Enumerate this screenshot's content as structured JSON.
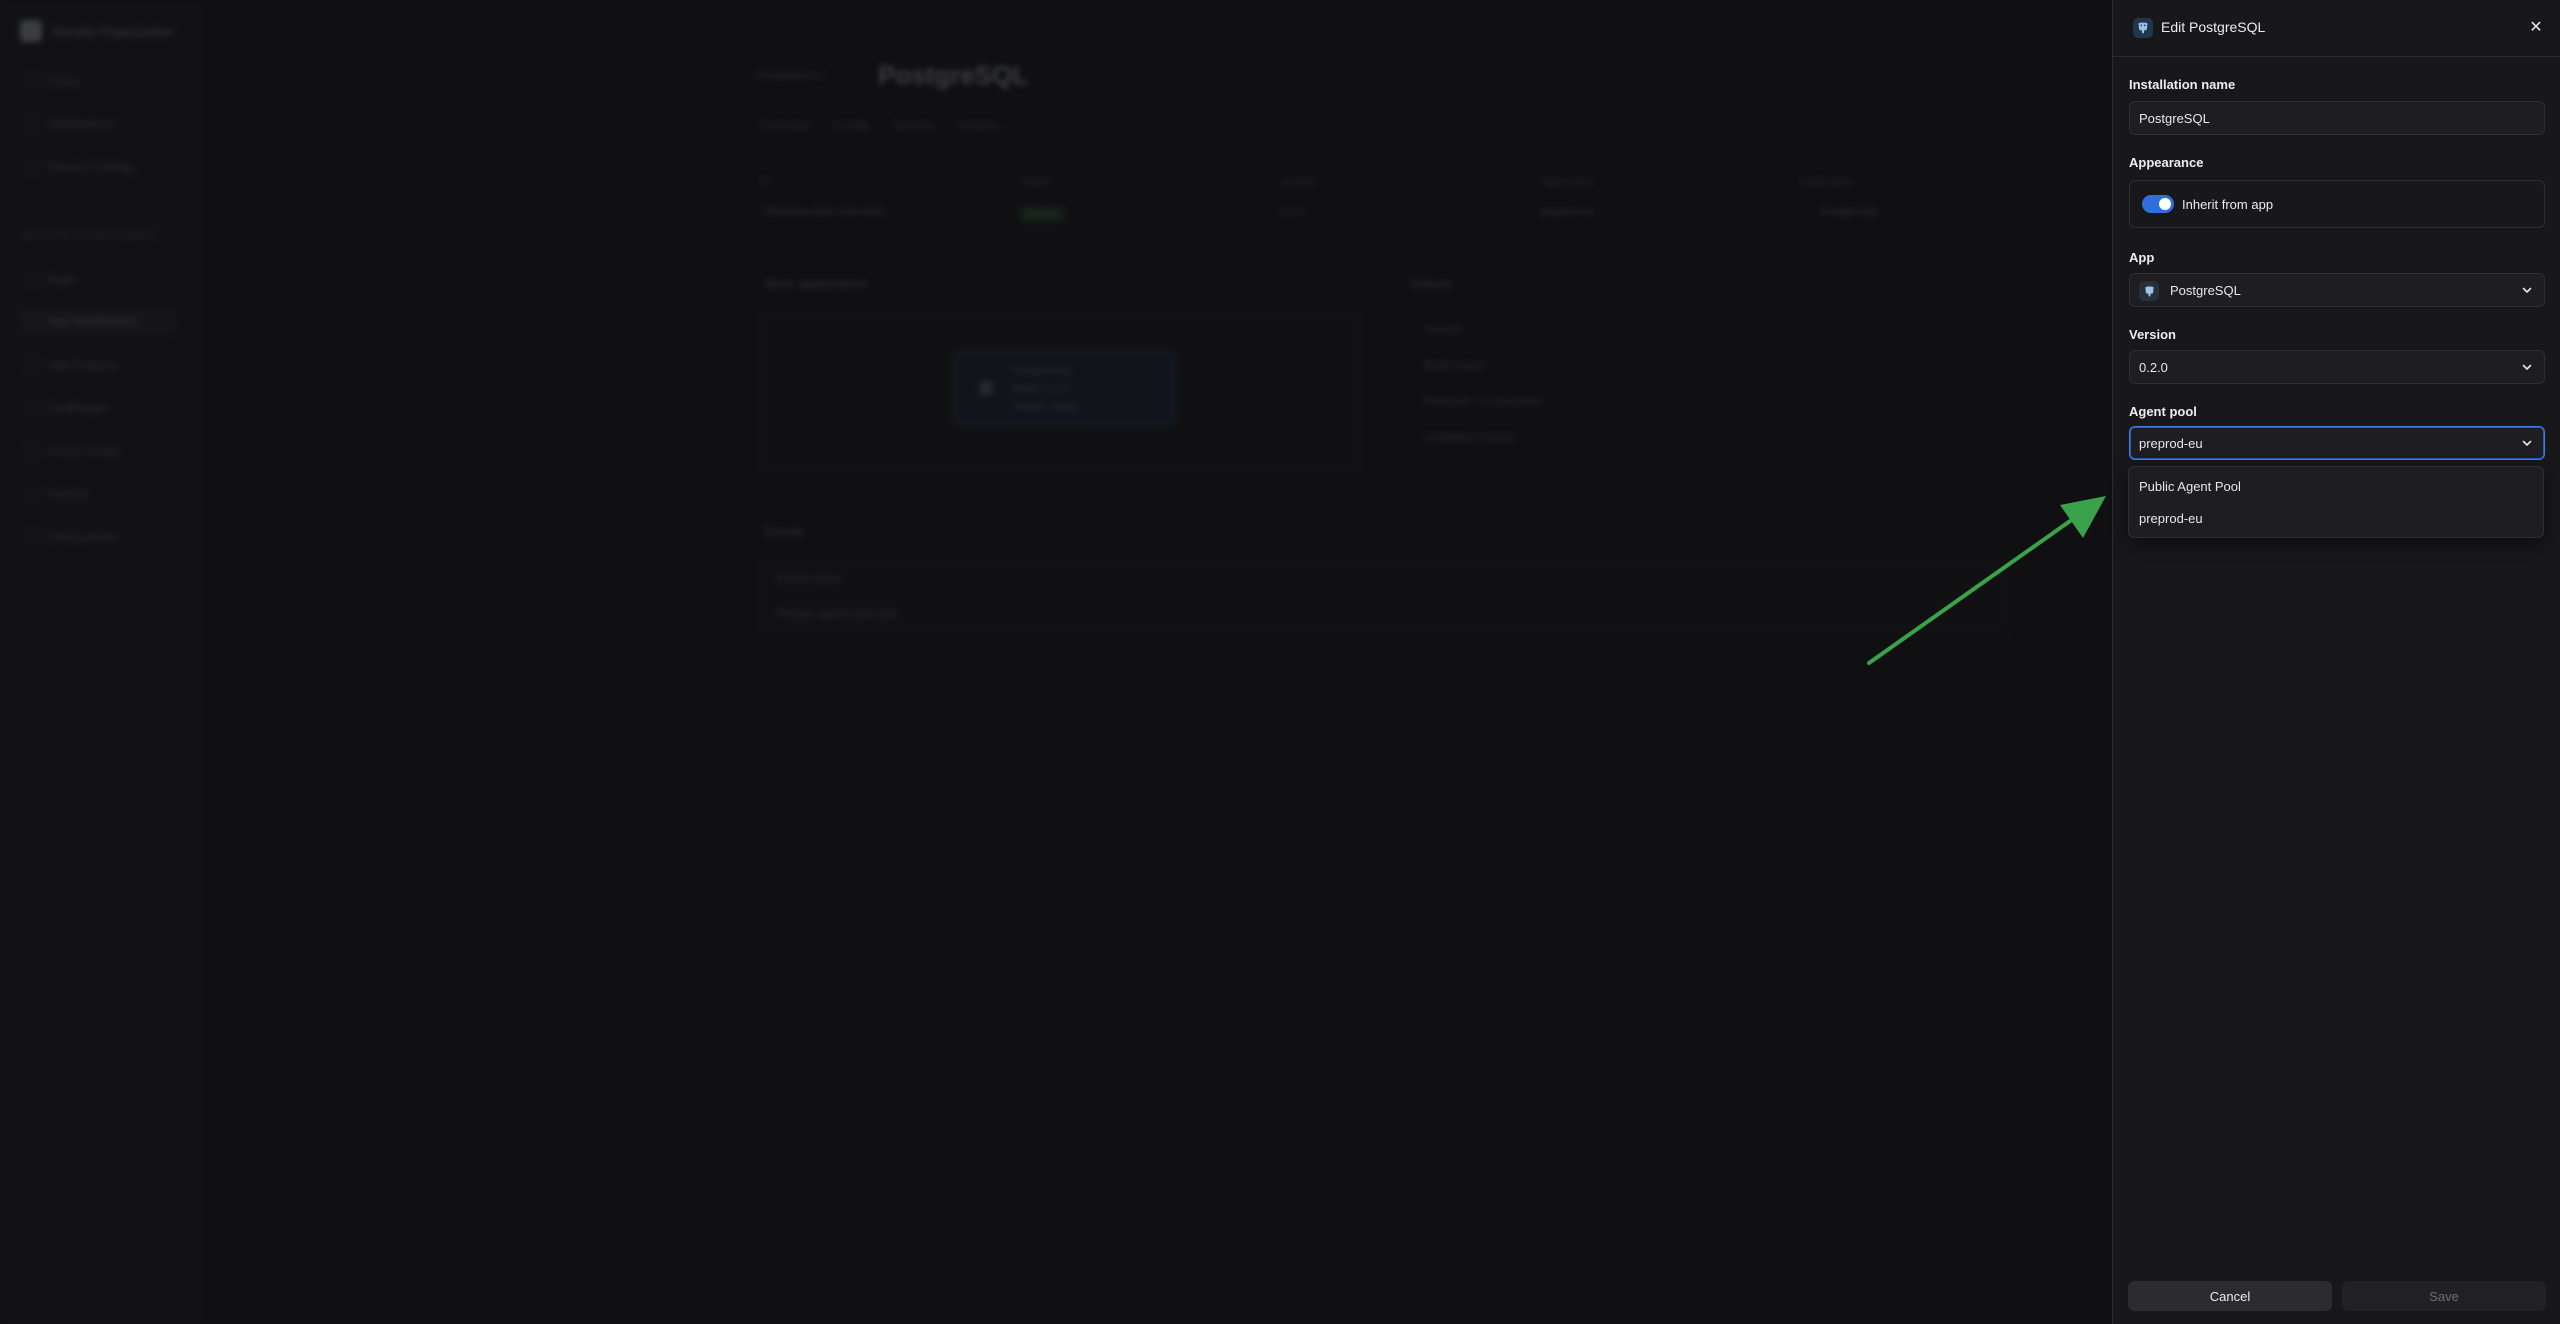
{
  "background": {
    "sidebar": {
      "org_name": "Sample Organization",
      "items": [
        "Home",
        "Notifications",
        "Service Catalog"
      ],
      "section_label": "DEVOPS ENVIRONMENT",
      "sub_items": [
        "Apps",
        "App Installations",
        "App Registry",
        "Certificates",
        "Cloud Config",
        "Secrets",
        "Observability"
      ]
    },
    "main": {
      "breadcrumb": "Installations /",
      "title": "PostgreSQL",
      "tabs": [
        "Overview",
        "Config",
        "Secrets",
        "Actions ⌄"
      ],
      "table_headers": [
        "ID",
        "Status",
        "Version",
        "Agent pool",
        "Application"
      ],
      "table_row": [
        "7d8c9e0a-de4f-11ef-ab01-...",
        "Ready",
        "0.2.0",
        "preprod-eu",
        "PostgreSQL"
      ],
      "appearance_title": "Store appearance",
      "preview_lines": [
        "PostgreSQL",
        "Build: 0.2.0",
        "Status: ready"
      ],
      "versions_title": "Actions",
      "versions_items": [
        "Search",
        "Build report",
        "Relocate / Connection",
        "Undeploy History"
      ],
      "events_title": "Events",
      "events_header": "Event name",
      "events_row": "Private agent pool tool"
    }
  },
  "drawer": {
    "title": "Edit PostgreSQL",
    "installation_name_label": "Installation name",
    "installation_name_value": "PostgreSQL",
    "appearance_label": "Appearance",
    "inherit_label": "Inherit from app",
    "inherit_enabled": true,
    "app_label": "App",
    "app_value": "PostgreSQL",
    "version_label": "Version",
    "version_value": "0.2.0",
    "agent_pool_label": "Agent pool",
    "agent_pool_value": "preprod-eu",
    "agent_pool_options": [
      "Public Agent Pool",
      "preprod-eu"
    ],
    "cancel_label": "Cancel",
    "save_label": "Save"
  },
  "colors": {
    "accent": "#2f6fdb",
    "annotation_arrow": "#3aa24a"
  }
}
